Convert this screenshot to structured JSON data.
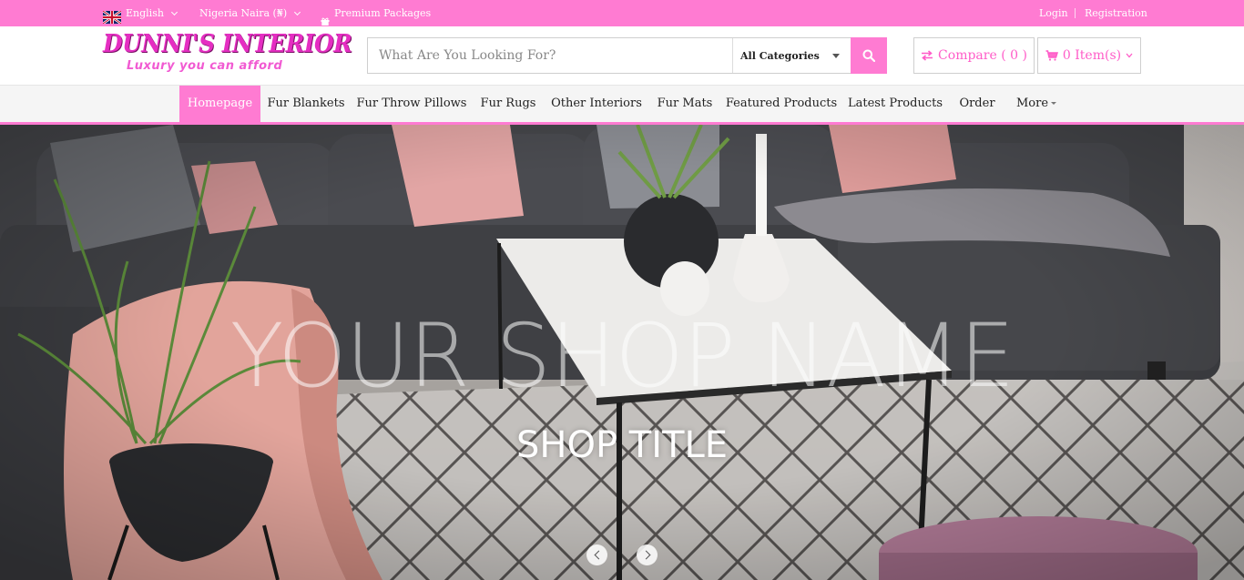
{
  "topbar": {
    "language": "English",
    "currency": "Nigeria Naira (₦)",
    "premium": "Premium Packages",
    "login": "Login",
    "registration": "Registration"
  },
  "header": {
    "logo_title": "DUNNI'S INTERIOR",
    "logo_tagline": "Luxury you can afford",
    "search_placeholder": "What Are You Looking For?",
    "category_selected": "All Categories",
    "compare_label": "Compare ( 0 )",
    "cart_label": "0 Item(s)"
  },
  "nav": {
    "items": [
      {
        "label": "Homepage",
        "active": true
      },
      {
        "label": "Fur Blankets"
      },
      {
        "label": "Fur Throw Pillows"
      },
      {
        "label": "Fur Rugs"
      },
      {
        "label": "Other Interiors"
      },
      {
        "label": "Fur Mats"
      },
      {
        "label": "Featured Products"
      },
      {
        "label": "Latest Products"
      },
      {
        "label": "Order"
      },
      {
        "label": "More"
      }
    ]
  },
  "hero": {
    "headline": "YOUR SHOP NAME",
    "subtitle": "SHOP TITLE"
  },
  "colors": {
    "accent": "#ff7bd2",
    "logo": "#e52ec2"
  }
}
